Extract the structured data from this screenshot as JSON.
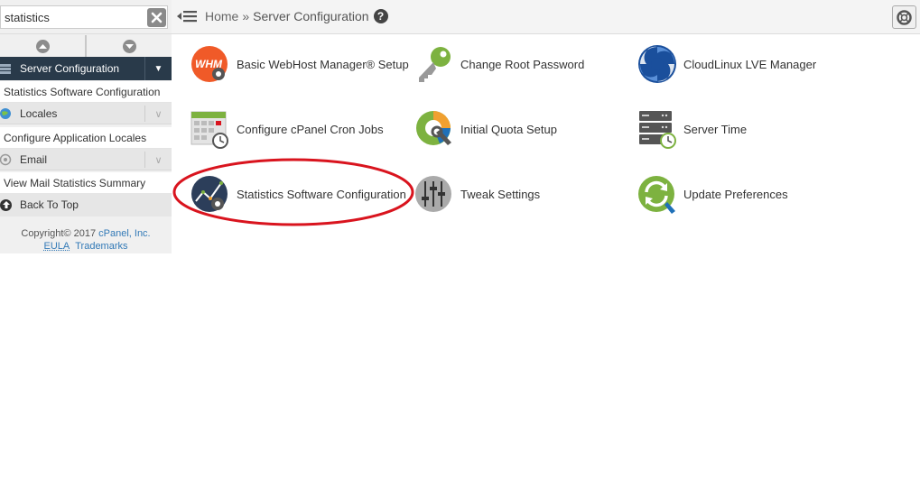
{
  "search": {
    "value": "statistics",
    "placeholder": ""
  },
  "sidebar": {
    "categories": [
      {
        "label": "Server Configuration",
        "icon": "server-config-icon",
        "expanded": true,
        "items": [
          "Statistics Software Configuration"
        ]
      },
      {
        "label": "Locales",
        "icon": "locales-icon",
        "expanded": false,
        "items": [
          "Configure Application Locales"
        ]
      },
      {
        "label": "Email",
        "icon": "email-icon",
        "expanded": false,
        "items": [
          "View Mail Statistics Summary"
        ]
      }
    ],
    "back_to_top": "Back To Top",
    "copyright": {
      "text": "Copyright© 2017 ",
      "company": "cPanel, Inc.",
      "eula": "EULA",
      "trademarks": "Trademarks"
    }
  },
  "breadcrumb": {
    "home": "Home",
    "separator": "»",
    "current": "Server Configuration",
    "help": "?"
  },
  "features": [
    {
      "label": "Basic WebHost Manager® Setup",
      "icon": "whm-setup-icon"
    },
    {
      "label": "Change Root Password",
      "icon": "key-icon"
    },
    {
      "label": "CloudLinux LVE Manager",
      "icon": "cloudlinux-icon"
    },
    {
      "label": "Configure cPanel Cron Jobs",
      "icon": "cron-calendar-icon"
    },
    {
      "label": "Initial Quota Setup",
      "icon": "quota-pie-icon"
    },
    {
      "label": "Server Time",
      "icon": "server-time-icon"
    },
    {
      "label": "Statistics Software Configuration",
      "icon": "statistics-icon"
    },
    {
      "label": "Tweak Settings",
      "icon": "tweak-sliders-icon"
    },
    {
      "label": "Update Preferences",
      "icon": "update-refresh-icon"
    }
  ],
  "colors": {
    "sidebar_header": "#293a4a",
    "highlight": "#d9141e",
    "accent": "#337ab7",
    "whm_orange": "#f05a28",
    "green": "#7db240"
  }
}
